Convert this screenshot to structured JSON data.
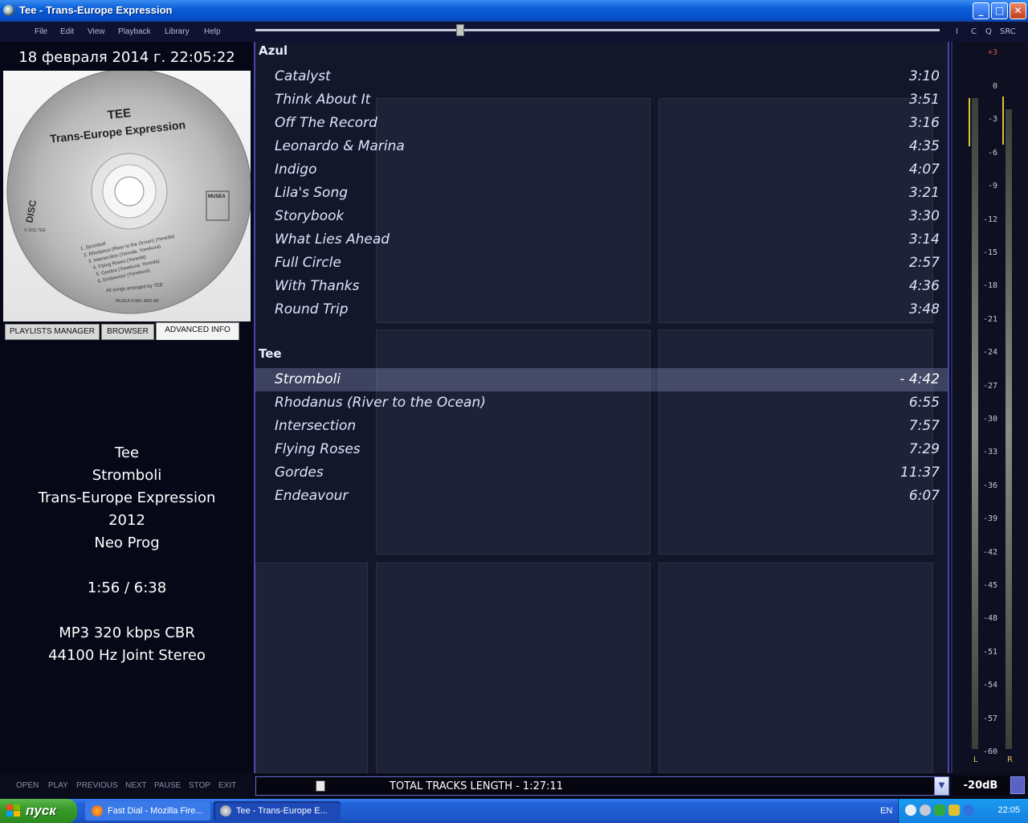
{
  "window": {
    "title": "Tee - Trans-Europe Expression",
    "minimize": "_",
    "maximize": "□",
    "close": "✕"
  },
  "menu": {
    "items": [
      "File",
      "Edit",
      "View",
      "Playback",
      "Library",
      "Help"
    ],
    "right_items": [
      "I",
      "C",
      "Q",
      "SRC"
    ]
  },
  "left_panel": {
    "datetime": "18 февраля 2014 г. 22:05:22",
    "tabs": [
      "PLAYLISTS MANAGER",
      "BROWSER",
      "ADVANCED INFO"
    ],
    "active_tab": "ADVANCED INFO",
    "disc": {
      "title_line1": "TEE",
      "title_line2": "Trans-Europe Expression",
      "tracklist": [
        "1. Stromboli",
        "2. Rhodanus (River to the Ocean) (Yoneda)",
        "3. Intersection (Yoneda, Yonekura)",
        "4. Flying Roses (Yoneda)",
        "5. Gordes (Yonekura, Yoneda)",
        "6. Endeavour (Yonekura)"
      ],
      "arranged": "All songs arranged by TEE",
      "catalog": "MUSEA FGBG 4892.AR",
      "label": "MUSEA",
      "copyright": "© 2011 TEE"
    },
    "track_info": {
      "artist": "Tee",
      "title": "Stromboli",
      "album": "Trans-Europe Expression",
      "year": "2012",
      "genre": "Neo Prog",
      "time": "1:56 / 6:38",
      "codec": "MP3  320 kbps CBR",
      "format": "44100 Hz  Joint Stereo"
    }
  },
  "playlist": {
    "groups": [
      {
        "name": "Azul",
        "tracks": [
          {
            "title": "Catalyst",
            "duration": "3:10"
          },
          {
            "title": "Think About It",
            "duration": "3:51"
          },
          {
            "title": "Off The Record",
            "duration": "3:16"
          },
          {
            "title": "Leonardo & Marina",
            "duration": "4:35"
          },
          {
            "title": "Indigo",
            "duration": "4:07"
          },
          {
            "title": "Lila's Song",
            "duration": "3:21"
          },
          {
            "title": "Storybook",
            "duration": "3:30"
          },
          {
            "title": "What Lies Ahead",
            "duration": "3:14"
          },
          {
            "title": "Full Circle",
            "duration": "2:57"
          },
          {
            "title": "With Thanks",
            "duration": "4:36"
          },
          {
            "title": "Round Trip",
            "duration": "3:48"
          }
        ]
      },
      {
        "name": "Tee",
        "tracks": [
          {
            "title": "Stromboli",
            "duration": "- 4:42",
            "playing": true
          },
          {
            "title": "Rhodanus (River to the Ocean)",
            "duration": "6:55"
          },
          {
            "title": "Intersection",
            "duration": "7:57"
          },
          {
            "title": "Flying Roses",
            "duration": "7:29"
          },
          {
            "title": "Gordes",
            "duration": "11:37"
          },
          {
            "title": "Endeavour",
            "duration": "6:07"
          }
        ]
      }
    ]
  },
  "vu_meter": {
    "ticks": [
      "+3",
      "0",
      "-3",
      "-6",
      "-9",
      "-12",
      "-15",
      "-18",
      "-21",
      "-24",
      "-27",
      "-30",
      "-33",
      "-36",
      "-39",
      "-42",
      "-45",
      "-48",
      "-51",
      "-54",
      "-57",
      "-60"
    ],
    "left_label": "L",
    "right_label": "R"
  },
  "controls": [
    "OPEN",
    "PLAY",
    "PREVIOUS",
    "NEXT",
    "PAUSE",
    "STOP",
    "EXIT"
  ],
  "status": {
    "text": "TOTAL  TRACKS LENGTH   -  1:27:11",
    "dropdown": "▼"
  },
  "volume": {
    "text": "-20dB"
  },
  "taskbar": {
    "start": "пуск",
    "items": [
      "Fast Dial - Mozilla Fire...",
      "Tee - Trans-Europe E..."
    ],
    "lang": "EN",
    "clock": "22:05"
  },
  "colors": {
    "accent": "#4848a8",
    "playing_row": "#5a6090",
    "title_bar": "#0a5ed8",
    "taskbar": "#2262d8"
  }
}
